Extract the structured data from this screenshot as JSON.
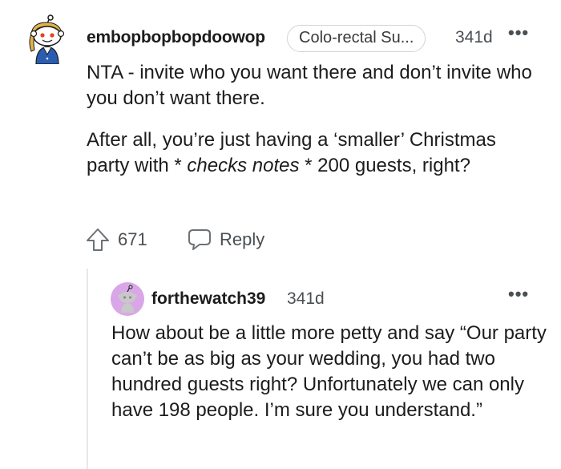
{
  "comment": {
    "username": "embopbopbopdoowop",
    "flair": "Colo-rectal Su...",
    "age": "341d",
    "more": "•••",
    "paragraph1": "NTA - invite who you want there and don’t invite who you don’t want there.",
    "paragraph2_before": "After all, you’re just having a ‘smaller’ Christmas party with * ",
    "paragraph2_italic": "checks notes",
    "paragraph2_after": " * 200 guests, right?",
    "score": "671",
    "reply_label": "Reply"
  },
  "reply": {
    "username": "forthewatch39",
    "age": "341d",
    "more": "•••",
    "body": "How about be a little more petty and say “Our party can’t be as big as your wedding, you had two hundred guests right? Unfortunately we can only have 198 people. I’m sure you understand.”"
  },
  "icons": {
    "avatar_1": "snoo-avatar-icon",
    "avatar_2": "snoo-avatar-icon",
    "upvote": "upvote-arrow-icon",
    "reply": "speech-bubble-icon"
  },
  "colors": {
    "text": "#1c1c1c",
    "meta": "#4a4f53",
    "flair_border": "#cfd4d8",
    "avatar_2_bg": "#d9a6e8"
  }
}
